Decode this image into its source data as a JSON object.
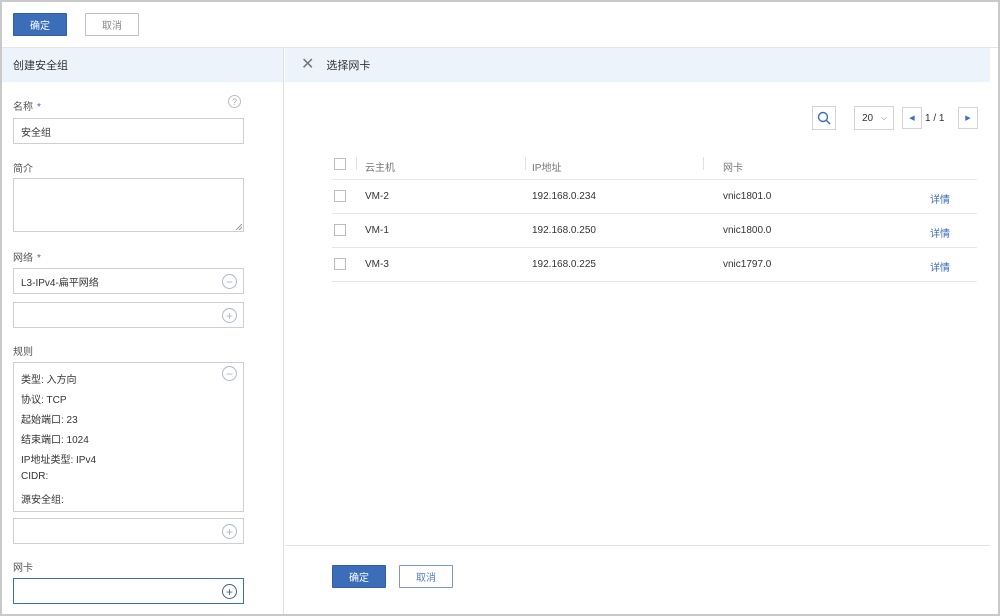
{
  "toolbar": {
    "confirm_label": "确定",
    "cancel_label": "取消"
  },
  "left": {
    "title": "创建安全组",
    "name_label": "名称",
    "name_required": "*",
    "name_value": "安全组",
    "desc_label": "简介",
    "network_label": "网络",
    "network_required": "*",
    "network_value": "L3-IPv4-扁平网络",
    "rules_label": "规则",
    "rules": [
      "类型: 入方向",
      "协议: TCP",
      "起始端口: 23",
      "结束端口: 1024",
      "IP地址类型: IPv4",
      "CIDR:",
      "源安全组:"
    ],
    "nic_label": "网卡"
  },
  "right": {
    "title": "选择网卡",
    "page_size": "20",
    "page_text": "1 / 1",
    "columns": [
      "云主机",
      "IP地址",
      "网卡"
    ],
    "rows": [
      {
        "vm": "VM-2",
        "ip": "192.168.0.234",
        "nic": "vnic1801.0",
        "action": "详情"
      },
      {
        "vm": "VM-1",
        "ip": "192.168.0.250",
        "nic": "vnic1800.0",
        "action": "详情"
      },
      {
        "vm": "VM-3",
        "ip": "192.168.0.225",
        "nic": "vnic1797.0",
        "action": "详情"
      }
    ],
    "confirm_label": "确定",
    "cancel_label": "取消"
  },
  "colors": {
    "accent": "#3b6db8",
    "header_bg": "#edf3fa",
    "border": "#cfcfcf"
  },
  "icons": [
    "help-icon",
    "remove-circle-icon",
    "add-circle-icon",
    "close-icon",
    "search-icon",
    "chevron-down-icon",
    "prev-page-icon",
    "next-page-icon"
  ]
}
